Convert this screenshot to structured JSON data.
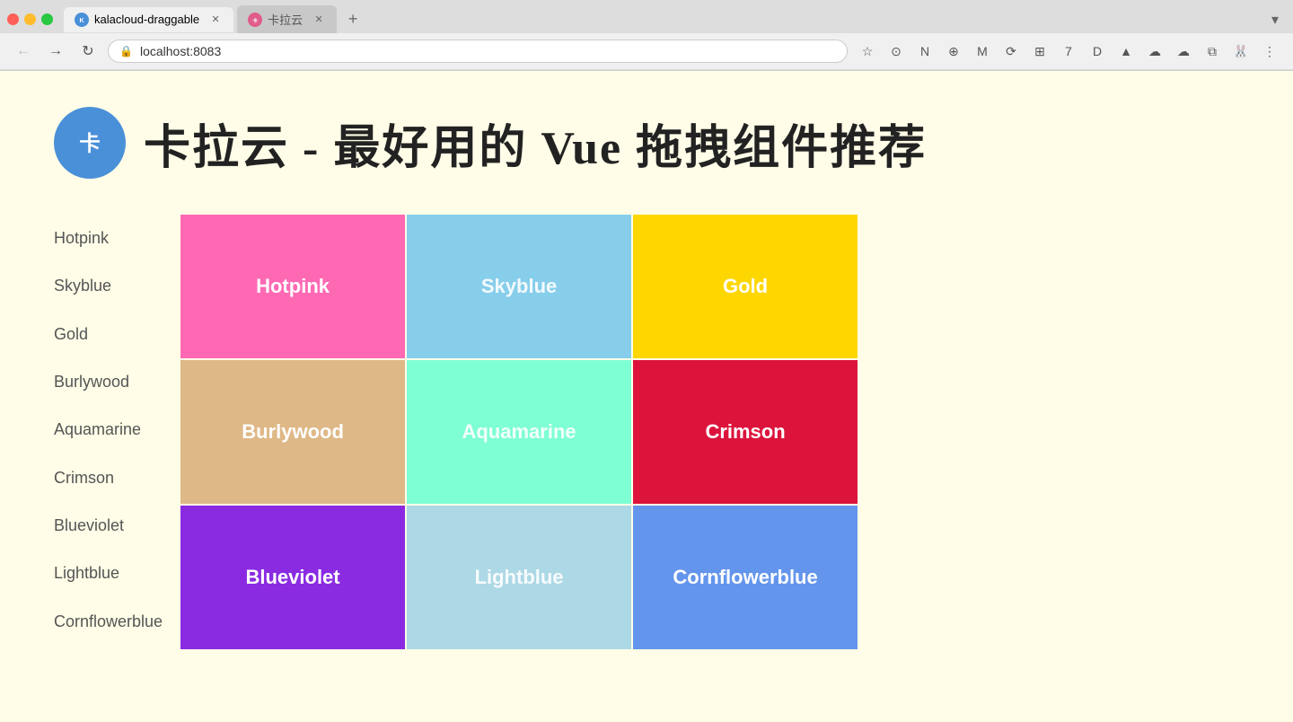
{
  "browser": {
    "tabs": [
      {
        "id": "tab1",
        "label": "kalacloud-draggable",
        "icon": "kala-icon",
        "icon_bg": "#4a90d9",
        "icon_text": "K",
        "active": true,
        "url": "localhost:8083"
      },
      {
        "id": "tab2",
        "label": "卡拉云",
        "icon": "kala2-icon",
        "icon_bg": "#e05c8a",
        "icon_text": "卡",
        "active": false,
        "url": ""
      }
    ],
    "address": "localhost:8083",
    "new_tab_label": "+",
    "dropdown_label": "▾"
  },
  "page": {
    "title": "卡拉云 - 最好用的 Vue 拖拽组件推荐",
    "logo_text": "卡"
  },
  "color_labels": [
    "Hotpink",
    "Skyblue",
    "Gold",
    "Burlywood",
    "Aquamarine",
    "Crimson",
    "Blueviolet",
    "Lightblue",
    "Cornflowerblue"
  ],
  "color_cells": [
    {
      "label": "Hotpink",
      "color": "#ff69b4",
      "row": 1,
      "col": 1
    },
    {
      "label": "Skyblue",
      "color": "#87ceeb",
      "row": 1,
      "col": 2
    },
    {
      "label": "Gold",
      "color": "#ffd700",
      "row": 1,
      "col": 3
    },
    {
      "label": "Burlywood",
      "color": "#deb887",
      "row": 2,
      "col": 1
    },
    {
      "label": "Aquamarine",
      "color": "#7fffd4",
      "row": 2,
      "col": 2
    },
    {
      "label": "Crimson",
      "color": "#dc143c",
      "row": 2,
      "col": 3
    },
    {
      "label": "Blueviolet",
      "color": "#8a2be2",
      "row": 3,
      "col": 1
    },
    {
      "label": "Lightblue",
      "color": "#add8e6",
      "row": 3,
      "col": 2
    },
    {
      "label": "Cornflowerblue",
      "color": "#6495ed",
      "row": 3,
      "col": 3
    }
  ]
}
